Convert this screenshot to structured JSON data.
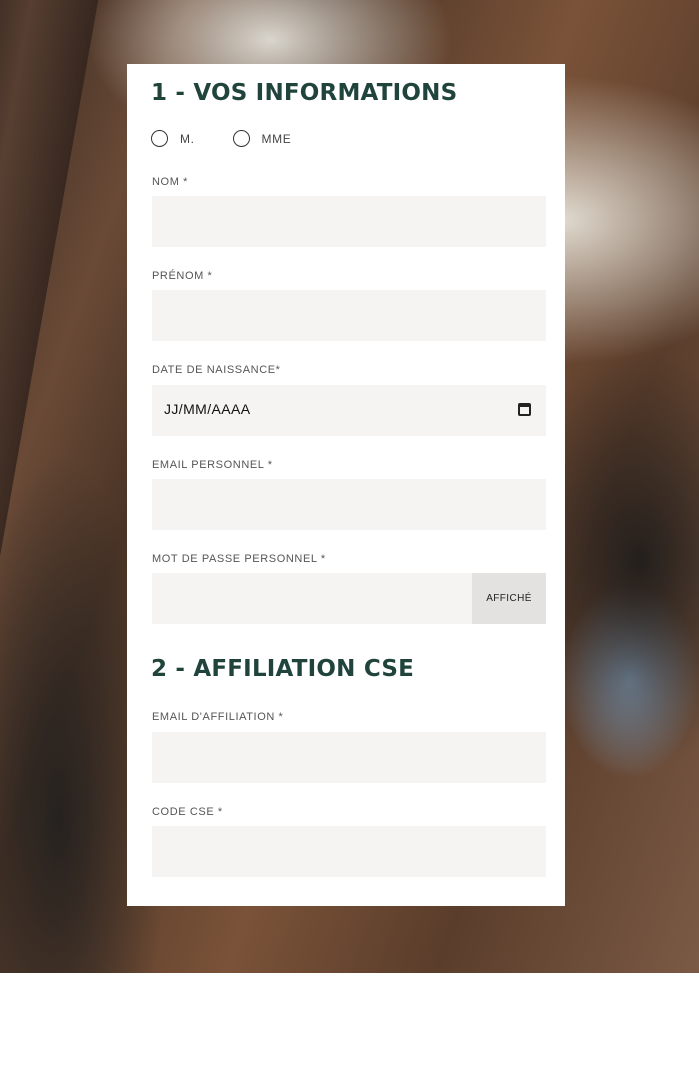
{
  "section1": {
    "title": "1 - VOS INFORMATIONS",
    "civility": {
      "option_m": "M.",
      "option_mme": "MME"
    },
    "nom_label": "NOM *",
    "prenom_label": "PRÉNOM *",
    "birthdate_label": "DATE DE NAISSANCE*",
    "birthdate_placeholder": "JJ/MM/AAAA",
    "email_label": "EMAIL PERSONNEL *",
    "password_label": "MOT DE PASSE PERSONNEL *",
    "password_toggle": "AFFICHÉ"
  },
  "section2": {
    "title": "2 - AFFILIATION CSE",
    "email_label": "EMAIL D'AFFILIATION *",
    "code_label": "CODE CSE *"
  },
  "colors": {
    "title": "#20443c",
    "field_bg": "#f5f4f2",
    "toggle_bg": "#e3e2e0"
  }
}
